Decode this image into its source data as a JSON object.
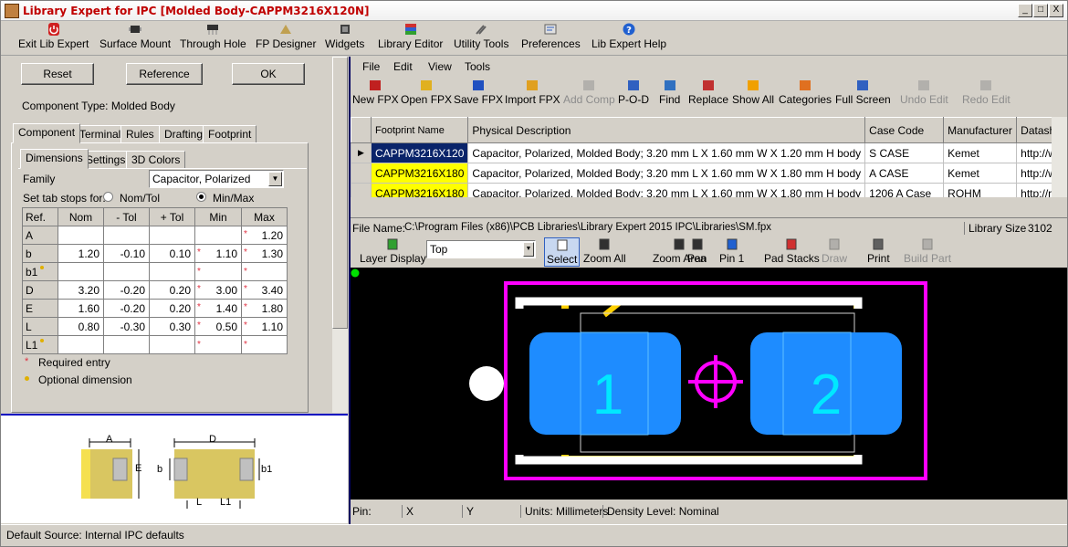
{
  "window": {
    "title": "Library Expert for IPC [Molded Body-CAPPM3216X120N]",
    "controls": [
      "_",
      "□",
      "X"
    ]
  },
  "main_toolbar": [
    {
      "label": "Exit Lib Expert",
      "icon": "power-icon"
    },
    {
      "label": "Surface Mount",
      "icon": "smd-chip-icon"
    },
    {
      "label": "Through Hole",
      "icon": "th-component-icon"
    },
    {
      "label": "FP Designer",
      "icon": "designer-icon"
    },
    {
      "label": "Widgets",
      "icon": "widgets-icon"
    },
    {
      "label": "Library Editor",
      "icon": "library-icon"
    },
    {
      "label": "Utility Tools",
      "icon": "tools-icon"
    },
    {
      "label": "Preferences",
      "icon": "preferences-icon"
    },
    {
      "label": "Lib Expert Help",
      "icon": "help-icon"
    }
  ],
  "left": {
    "reset": "Reset",
    "reference": "Reference",
    "ok": "OK",
    "component_type": "Component Type: Molded Body",
    "tabs": [
      "Component",
      "Terminal",
      "Rules",
      "Drafting",
      "Footprint"
    ],
    "subtabs": [
      "Dimensions",
      "Settings",
      "3D Colors"
    ],
    "family_label": "Family",
    "family_value": "Capacitor, Polarized",
    "tabstops_label": "Set tab stops for:",
    "opt_nomtol": "Nom/Tol",
    "opt_minmax": "Min/Max",
    "table_headers": [
      "Ref.",
      "Nom",
      "- Tol",
      "+ Tol",
      "Min",
      "Max"
    ],
    "rows": [
      {
        "ref": "A",
        "nom": "",
        "mtol": "",
        "ptol": "",
        "min": "",
        "max": "1.20",
        "min_req": false,
        "max_req": true,
        "opt": false
      },
      {
        "ref": "b",
        "nom": "1.20",
        "mtol": "-0.10",
        "ptol": "0.10",
        "min": "1.10",
        "max": "1.30",
        "min_req": true,
        "max_req": true,
        "opt": false
      },
      {
        "ref": "b1",
        "nom": "",
        "mtol": "",
        "ptol": "",
        "min": "",
        "max": "",
        "min_req": true,
        "max_req": true,
        "opt": true
      },
      {
        "ref": "D",
        "nom": "3.20",
        "mtol": "-0.20",
        "ptol": "0.20",
        "min": "3.00",
        "max": "3.40",
        "min_req": true,
        "max_req": true,
        "opt": false
      },
      {
        "ref": "E",
        "nom": "1.60",
        "mtol": "-0.20",
        "ptol": "0.20",
        "min": "1.40",
        "max": "1.80",
        "min_req": true,
        "max_req": true,
        "opt": false
      },
      {
        "ref": "L",
        "nom": "0.80",
        "mtol": "-0.30",
        "ptol": "0.30",
        "min": "0.50",
        "max": "1.10",
        "min_req": true,
        "max_req": true,
        "opt": false
      },
      {
        "ref": "L1",
        "nom": "",
        "mtol": "",
        "ptol": "",
        "min": "",
        "max": "",
        "min_req": true,
        "max_req": true,
        "opt": true
      }
    ],
    "legend_required": "Required entry",
    "legend_optional": "Optional dimension",
    "diagram_labels": {
      "A": "A",
      "E": "E",
      "D": "D",
      "b": "b",
      "b1": "b1",
      "L": "L",
      "L1": "L1"
    }
  },
  "status": {
    "default_source": "Default Source:  Internal IPC defaults"
  },
  "right": {
    "menu": [
      "File",
      "Edit",
      "View",
      "Tools"
    ],
    "toolbar": [
      {
        "label": "New FPX",
        "icon": "new-fpx-icon",
        "enabled": true
      },
      {
        "label": "Open FPX",
        "icon": "open-folder-icon",
        "enabled": true
      },
      {
        "label": "Save FPX",
        "icon": "save-icon",
        "enabled": true
      },
      {
        "label": "Import FPX",
        "icon": "import-icon",
        "enabled": true
      },
      {
        "label": "Add Comp",
        "icon": "add-comp-icon",
        "enabled": false
      },
      {
        "label": "P-O-D",
        "icon": "pod-icon",
        "enabled": true
      },
      {
        "label": "Find",
        "icon": "find-icon",
        "enabled": true
      },
      {
        "label": "Replace",
        "icon": "replace-icon",
        "enabled": true
      },
      {
        "label": "Show All",
        "icon": "star-icon",
        "enabled": true
      },
      {
        "label": "Categories",
        "icon": "categories-icon",
        "enabled": true
      },
      {
        "label": "Full Screen",
        "icon": "fullscreen-icon",
        "enabled": true
      },
      {
        "label": "Undo Edit",
        "icon": "undo-icon",
        "enabled": false
      },
      {
        "label": "Redo Edit",
        "icon": "redo-icon",
        "enabled": false
      }
    ],
    "grid_headers": [
      "Footprint Name",
      "Physical Description",
      "Case Code",
      "Manufacturer",
      "Datasheet"
    ],
    "grid_rows": [
      {
        "name": "CAPPM3216X120",
        "desc": "Capacitor, Polarized, Molded Body; 3.20 mm L X 1.60 mm W X 1.20 mm H body",
        "case": "S CASE",
        "mfr": "Kemet",
        "ds": "http://www.kemet.c"
      },
      {
        "name": "CAPPM3216X180",
        "desc": "Capacitor, Polarized, Molded Body; 3.20 mm L X 1.60 mm W X 1.80 mm H body",
        "case": "A CASE",
        "mfr": "Kemet",
        "ds": "http://www.kemet.c"
      },
      {
        "name": "CAPPM3216X180",
        "desc": "Capacitor, Polarized, Molded Body; 3.20 mm L X 1.60 mm W X 1.80 mm H body",
        "case": "1206 A Case",
        "mfr": "ROHM",
        "ds": "http://rohmfs.rohm"
      }
    ],
    "file_name_label": "File Name:",
    "file_name": "C:\\Program Files (x86)\\PCB Libraries\\Library Expert 2015 IPC\\Libraries\\SM.fpx",
    "library_size_label": "Library Size",
    "library_size": "3102",
    "view_toolbar": [
      {
        "label": "Layer Display",
        "icon": "layers-icon",
        "enabled": true
      },
      {
        "label": "Select",
        "icon": "cursor-icon",
        "enabled": true
      },
      {
        "label": "Zoom All",
        "icon": "zoom-all-icon",
        "enabled": true
      },
      {
        "label": "Zoom Area",
        "icon": "zoom-area-icon",
        "enabled": true
      },
      {
        "label": "Pan",
        "icon": "pan-icon",
        "enabled": true
      },
      {
        "label": "Pin 1",
        "icon": "pin1-icon",
        "enabled": true
      },
      {
        "label": "Pad Stacks",
        "icon": "pad-stacks-icon",
        "enabled": true
      },
      {
        "label": "Draw",
        "icon": "draw-icon",
        "enabled": false
      },
      {
        "label": "Print",
        "icon": "print-icon",
        "enabled": true
      },
      {
        "label": "Build Part",
        "icon": "build-icon",
        "enabled": false
      }
    ],
    "layer_value": "Top",
    "pad_labels": [
      "1",
      "2"
    ],
    "colors": {
      "pad": "#1e8cff",
      "silk": "#ffffff",
      "courtyard": "#ff00ff",
      "assembly": "#ffd000"
    },
    "status": {
      "pin": "Pin:",
      "x": "X",
      "y": "Y",
      "units": "Units: Millimeters",
      "density": "Density Level: Nominal"
    }
  }
}
